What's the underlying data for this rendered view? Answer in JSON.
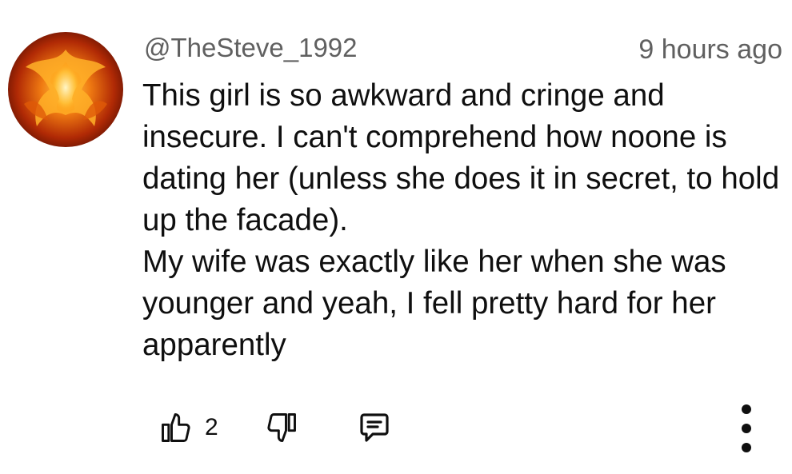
{
  "comment": {
    "author": "@TheSteve_1992",
    "timestamp": "9 hours ago",
    "body_paragraphs": [
      "This girl is so awkward and cringe and insecure. I can't comprehend how noone is dating her (unless she does it in secret, to hold up the facade).",
      "My wife was exactly like her when she was younger and yeah, I fell pretty hard for her apparently"
    ],
    "like_count": "2",
    "avatar_icon": "phoenix-fire-avatar"
  },
  "actions": {
    "like_icon": "thumbs-up-icon",
    "dislike_icon": "thumbs-down-icon",
    "reply_icon": "reply-comment-icon",
    "more_icon": "more-vert-icon"
  },
  "colors": {
    "text_primary": "#0f0f0f",
    "text_secondary": "#606060",
    "background": "#ffffff"
  }
}
